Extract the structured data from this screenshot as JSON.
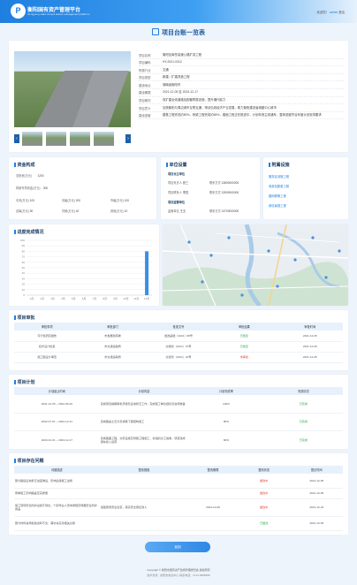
{
  "header": {
    "brand_title": "衡阳国有资产管理平台",
    "brand_subtitle": "Hengyang state-owned assets management platform",
    "welcome_prefix": "欢迎您！",
    "username": "admin",
    "logout": "退出"
  },
  "page_title": "项目台账一览表",
  "project_info": [
    {
      "k": "项目名称",
      "v": "衡阳至南岳高速公路扩容工程"
    },
    {
      "k": "项目编码",
      "v": "HY-2021-0312"
    },
    {
      "k": "所属行业",
      "v": "交通"
    },
    {
      "k": "项目类型",
      "v": "新建／扩建改造工程"
    },
    {
      "k": "建设地点",
      "v": "湖南省衡阳市"
    },
    {
      "k": "建设期限",
      "v": "2021-12-05 至 2023-12-17"
    },
    {
      "k": "项目概况",
      "v": "改扩建全线道路及配套附属设施，提升通行能力"
    },
    {
      "k": "项目意义",
      "v": "加快衡阳与周边城市互联互通，带动沿线经济产业发展，助力衡阳建设省域副中心城市"
    },
    {
      "k": "建设进度",
      "v": "路基工程完成约80%，桥梁工程完成约65%，路面工程正在推进中，计划年底主线通车，整体进度符合年度计划安排要求"
    }
  ],
  "funds": {
    "title": "资金构成",
    "rows": [
      [
        {
          "k": "总投资(万元)",
          "v": "1200"
        }
      ],
      [
        {
          "k": "财政专项资金(万元)",
          "v": "300"
        }
      ],
      [
        {
          "k": "中央(万元)",
          "v": "100"
        },
        {
          "k": "省级(万元)",
          "v": "200"
        },
        {
          "k": "市级(万元)",
          "v": "100"
        }
      ],
      [
        {
          "k": "自筹(万元)",
          "v": "50"
        },
        {
          "k": "贷款(万元)",
          "v": "40"
        },
        {
          "k": "其他(万元)",
          "v": "10"
        }
      ]
    ]
  },
  "units": {
    "title": "单位设置",
    "owner_label": "项目业主单位",
    "owner_rows": [
      {
        "k1": "项目负责人",
        "v1": "张三",
        "k2": "联系方式",
        "v2": "13800000000"
      },
      {
        "k1": "项目联系人",
        "v1": "李四",
        "k2": "联系方式",
        "v2": "13900000000"
      }
    ],
    "supervisor_label": "项目监管单位",
    "supervisor_row": {
      "k1": "监管单位",
      "v1": "王五",
      "k2": "联系方式",
      "v2": "13700000000"
    }
  },
  "related": {
    "title": "附属设施",
    "items": [
      "服务区设施工程",
      "收费站配套工程",
      "路网照明工程",
      "绿化景观工程"
    ]
  },
  "progress": {
    "title": "进度完成情况"
  },
  "chart_data": {
    "type": "bar",
    "title": "",
    "categories": [
      "1月",
      "2月",
      "3月",
      "4月",
      "5月",
      "6月",
      "7月",
      "8月",
      "9月",
      "10月",
      "11月",
      "12月"
    ],
    "values": [
      0,
      0,
      0,
      0,
      0,
      0,
      0,
      0,
      0,
      0,
      0,
      80
    ],
    "ylim": [
      0,
      100
    ],
    "yticks": [
      0,
      10,
      20,
      30,
      40,
      50,
      60,
      70,
      80,
      90,
      100
    ],
    "grid": true,
    "bar_color": "#3a8ee6"
  },
  "approval": {
    "title": "项目审批",
    "headers": [
      "审批事项",
      "审批部门",
      "批准文号",
      "审批结果",
      "审批时间"
    ],
    "rows": [
      {
        "c1": "可行性研究报告",
        "c2": "市发展改革委",
        "c3": "发改基础〔2021〕88号",
        "c4": "已批复",
        "c5": "2021-12-05"
      },
      {
        "c1": "初步设计批复",
        "c2": "市交通运输局",
        "c3": "交规划〔2021〕15号",
        "c4": "已批复",
        "c5": "2021-12-05"
      },
      {
        "c1": "施工图设计审查",
        "c2": "市交通运输局",
        "c3": "交建管〔2021〕20号",
        "c4": "未审批",
        "c5": "2021-12-05"
      }
    ]
  },
  "plan": {
    "title": "项目计划",
    "headers": [
      "计划起止时间",
      "计划内容",
      "计划完成率",
      "完成情况"
    ],
    "rows": [
      {
        "c1": "2021-12-05 ~ 2022-06-30",
        "c2": "完成项目前期审批手续及征地拆迁工作，完成施工单位招标及进场准备",
        "c3": "100%",
        "c4": "已完成"
      },
      {
        "c1": "2022-07-01 ~ 2022-12-31",
        "c2": "完成路基土石方及桥梁下部结构施工",
        "c3": "80%",
        "c4": "已完成"
      },
      {
        "c1": "2023-01-01 ~ 2023-12-17",
        "c2": "完成路面工程、交安设施及附属工程施工，并组织交工验收，项目建成通车投入运营",
        "c3": "60%",
        "c4": "已完成"
      }
    ]
  },
  "issues": {
    "title": "项目存在问题",
    "headers": [
      "问题描述",
      "整改措施",
      "整改期限",
      "整改状态",
      "登记时间"
    ],
    "rows": [
      {
        "c1": "部分路段征地拆迁进度滞后，影响后续施工进场",
        "c2": "",
        "c3": "",
        "c4": "整改中",
        "c5": "2021-12-05"
      },
      {
        "c1": "雨季施工影响路基压实质量",
        "c2": "",
        "c3": "",
        "c4": "整改中",
        "c5": "2021-12-05"
      },
      {
        "c1": "施工现场安全防护设施不到位，个别作业人员未按规定佩戴安全防护用品",
        "c2": "加强现场安全巡查，落实安全责任到人",
        "c3": "2021-12-08",
        "c4": "整改中",
        "c5": "2021-12-23"
      },
      {
        "c1": "部分材料进场检验资料不全，需补充完善相关台账",
        "c2": "",
        "c3": "",
        "c4": "已整改",
        "c5": "2021-12-05"
      }
    ]
  },
  "more_button": "返回",
  "footer": {
    "line1": "Copyright © 衡阳市国有资产监督管理委员会 版权所有",
    "line2": "技术支持：衡阳市信息中心 联系电话：0734-8888888"
  }
}
